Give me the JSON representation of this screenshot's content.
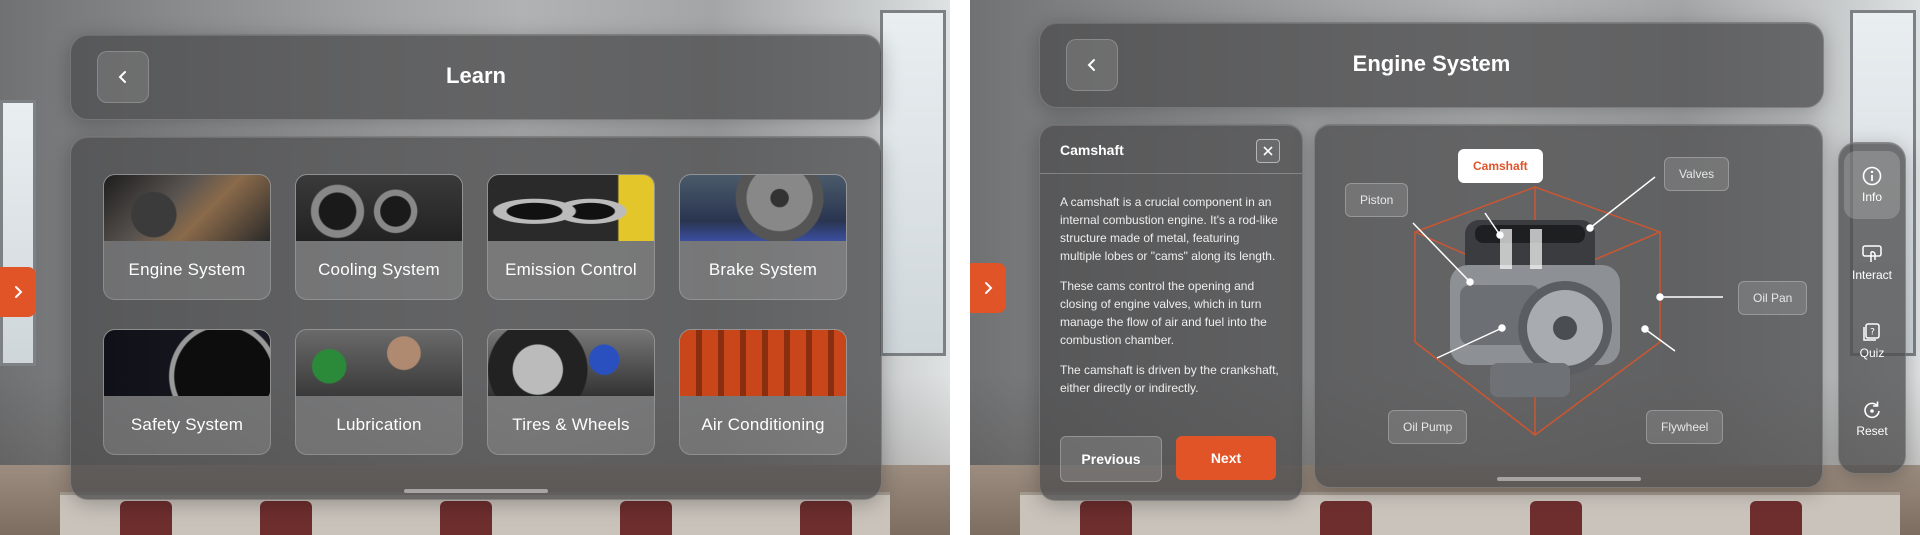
{
  "left_panel": {
    "header": {
      "title": "Learn"
    },
    "categories": [
      {
        "label": "Engine System"
      },
      {
        "label": "Cooling System"
      },
      {
        "label": "Emission Control"
      },
      {
        "label": "Brake System"
      },
      {
        "label": "Safety System"
      },
      {
        "label": "Lubrication"
      },
      {
        "label": "Tires & Wheels"
      },
      {
        "label": "Air Conditioning"
      }
    ]
  },
  "right_panel": {
    "header": {
      "title": "Engine System"
    },
    "info_card": {
      "title": "Camshaft",
      "paragraphs": [
        "A camshaft is a crucial component in an internal combustion engine. It's a rod-like structure made of metal, featuring multiple lobes or \"cams\" along its length.",
        "These cams control the opening and closing of engine valves, which in turn manage the flow of air and fuel into the combustion chamber.",
        "The camshaft is driven by the crankshaft, either directly or indirectly."
      ],
      "previous_label": "Previous",
      "next_label": "Next"
    },
    "engine_labels": {
      "camshaft": "Camshaft",
      "valves": "Valves",
      "piston": "Piston",
      "oil_pan": "Oil Pan",
      "oil_pump": "Oil Pump",
      "flywheel": "Flywheel"
    },
    "rail": [
      {
        "label": "Info",
        "icon": "info-icon"
      },
      {
        "label": "Interact",
        "icon": "interact-icon"
      },
      {
        "label": "Quiz",
        "icon": "quiz-icon"
      },
      {
        "label": "Reset",
        "icon": "reset-icon"
      }
    ]
  },
  "colors": {
    "accent": "#e05428",
    "panel": "#4e4e50"
  }
}
